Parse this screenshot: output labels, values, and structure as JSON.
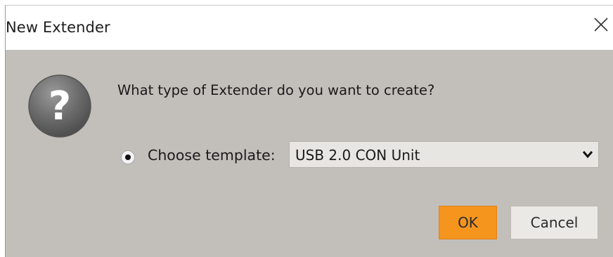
{
  "window": {
    "title": "New Extender",
    "close_icon": "close-icon"
  },
  "message": {
    "icon": "question-mark-icon",
    "text": "What type of Extender do you want to create?"
  },
  "template_option": {
    "selected": true,
    "label": "Choose template:",
    "select_value": "USB 2.0 CON Unit",
    "dropdown_icon": "chevron-down-icon"
  },
  "buttons": {
    "ok_label": "OK",
    "cancel_label": "Cancel"
  },
  "colors": {
    "dialog_bg": "#c2bfbb",
    "titlebar_bg": "#ffffff",
    "ok_accent": "#f5951e",
    "icon_gray": "#6b6b6b"
  }
}
